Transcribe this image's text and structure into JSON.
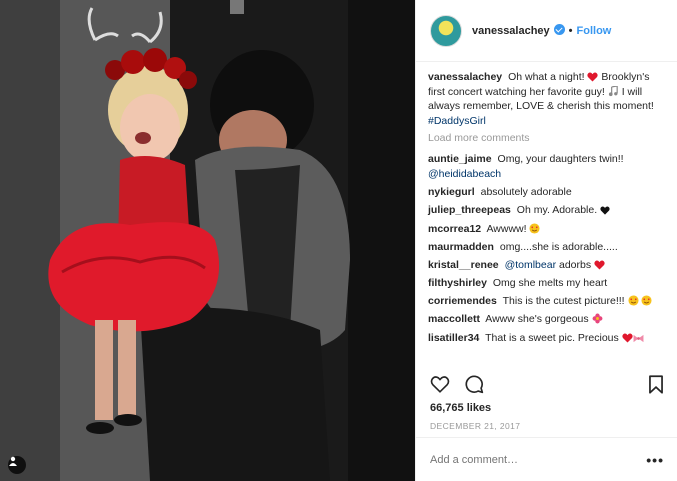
{
  "header": {
    "username": "vanessalachey",
    "dot": "•",
    "follow_label": "Follow"
  },
  "caption": {
    "username": "vanessalachey",
    "text_1": "Oh what a night!",
    "text_2": "Brooklyn's first concert watching her favorite guy!",
    "text_3": "I will always remember, LOVE & cherish this moment!",
    "hashtag": "#DaddysGirl"
  },
  "load_more": "Load more comments",
  "comments": [
    {
      "user": "auntie_jaime",
      "text": "Omg, your daughters twin!!",
      "mention": "@heididabeach"
    },
    {
      "user": "nykiegurl",
      "text": "absolutely adorable"
    },
    {
      "user": "juliep_threepeas",
      "text": "Oh my. Adorable."
    },
    {
      "user": "mcorrea12",
      "text": "Awwww!"
    },
    {
      "user": "maurmadden",
      "text": "omg....she is adorable....."
    },
    {
      "user": "kristal__renee",
      "mention": "@tomlbear",
      "text": "adorbs"
    },
    {
      "user": "filthyshirley",
      "text": "Omg she melts my heart"
    },
    {
      "user": "corriemendes",
      "text": "This is the cutest picture!!!"
    },
    {
      "user": "maccollett",
      "text": "Awww she's gorgeous"
    },
    {
      "user": "lisatiller34",
      "text": "That is a sweet pic. Precious"
    }
  ],
  "likes": "66,765 likes",
  "date": "DECEMBER 21, 2017",
  "add_comment_placeholder": "Add a comment…",
  "more_label": "•••",
  "icons": {
    "like": "heart-icon",
    "comment": "comment-icon",
    "save": "bookmark-icon",
    "tagged": "person-tag-icon",
    "verified": "verified-badge-icon"
  },
  "colors": {
    "link": "#3897f0",
    "hashtag": "#003569",
    "muted": "#999999",
    "heart": "#ed4956"
  }
}
